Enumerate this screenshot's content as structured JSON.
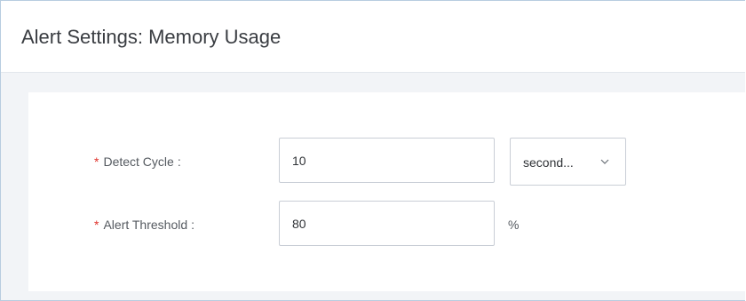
{
  "dialog": {
    "title": "Alert Settings: Memory Usage"
  },
  "form": {
    "detect_cycle": {
      "required_mark": "*",
      "label": "Detect Cycle",
      "colon": ":",
      "value": "10",
      "unit_select": {
        "selected": "second...",
        "icon": "chevron-down-icon"
      }
    },
    "alert_threshold": {
      "required_mark": "*",
      "label": "Alert Threshold",
      "colon": ":",
      "value": "80",
      "unit": "%"
    }
  },
  "colors": {
    "required_mark": "#e0322b",
    "frame_border": "#b8cde0",
    "background": "#f2f4f7"
  }
}
